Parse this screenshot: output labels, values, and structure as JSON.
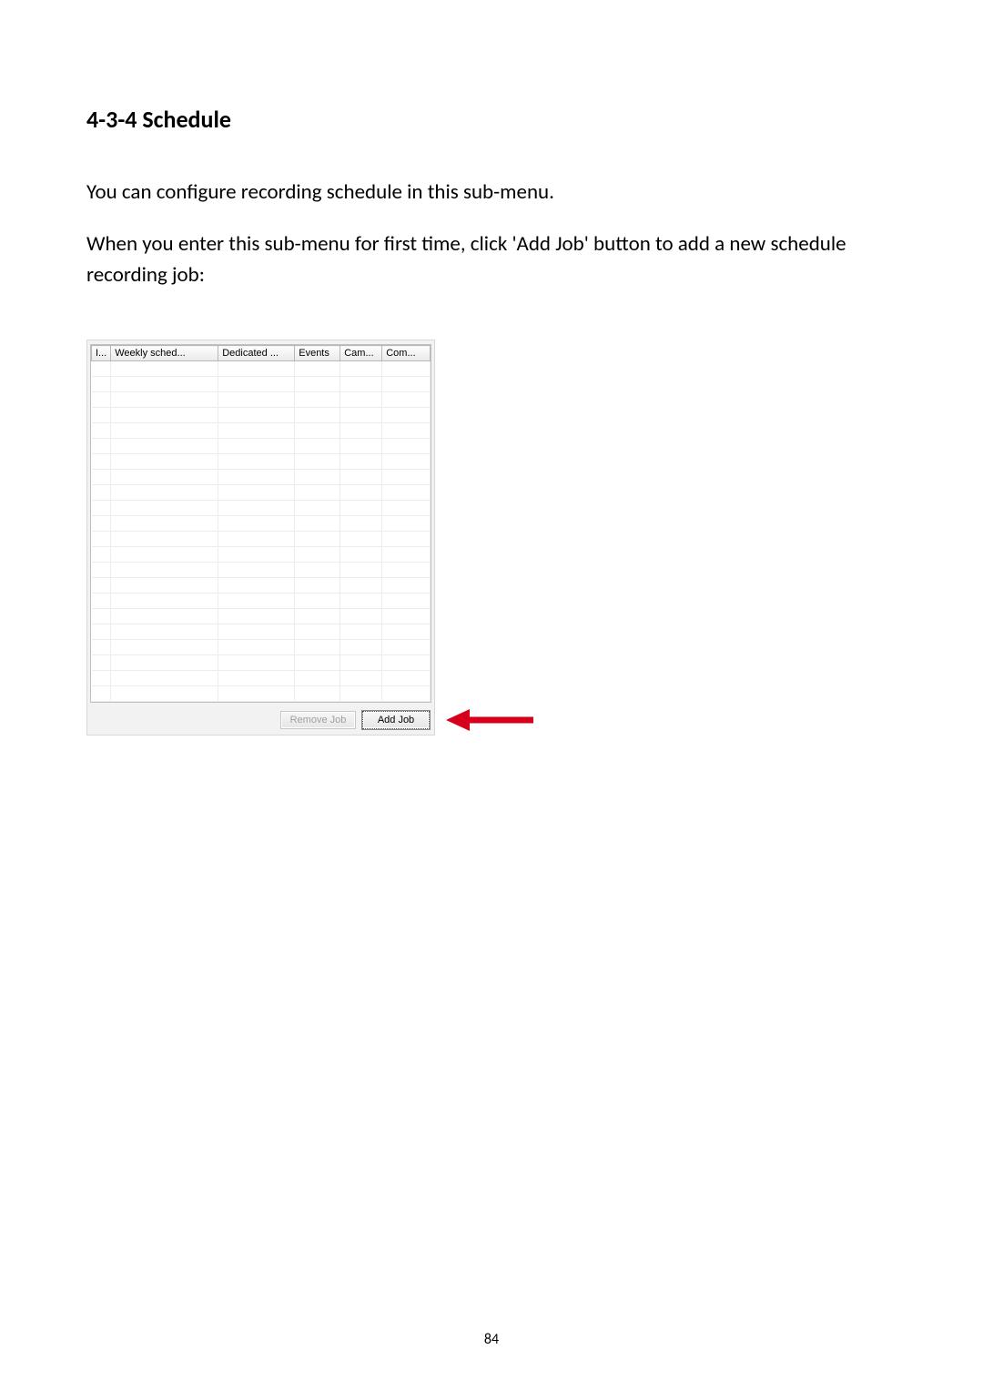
{
  "heading": "4-3-4 Schedule",
  "para1": "You can configure recording schedule in this sub-menu.",
  "para2": "When you enter this sub-menu for first time, click 'Add Job' button to add a new schedule recording job:",
  "table": {
    "headers": [
      "I...",
      "Weekly sched...",
      "Dedicated ...",
      "Events",
      "Cam...",
      "Com..."
    ],
    "empty_row_count": 22
  },
  "buttons": {
    "remove": "Remove Job",
    "add": "Add Job"
  },
  "page_number": "84"
}
